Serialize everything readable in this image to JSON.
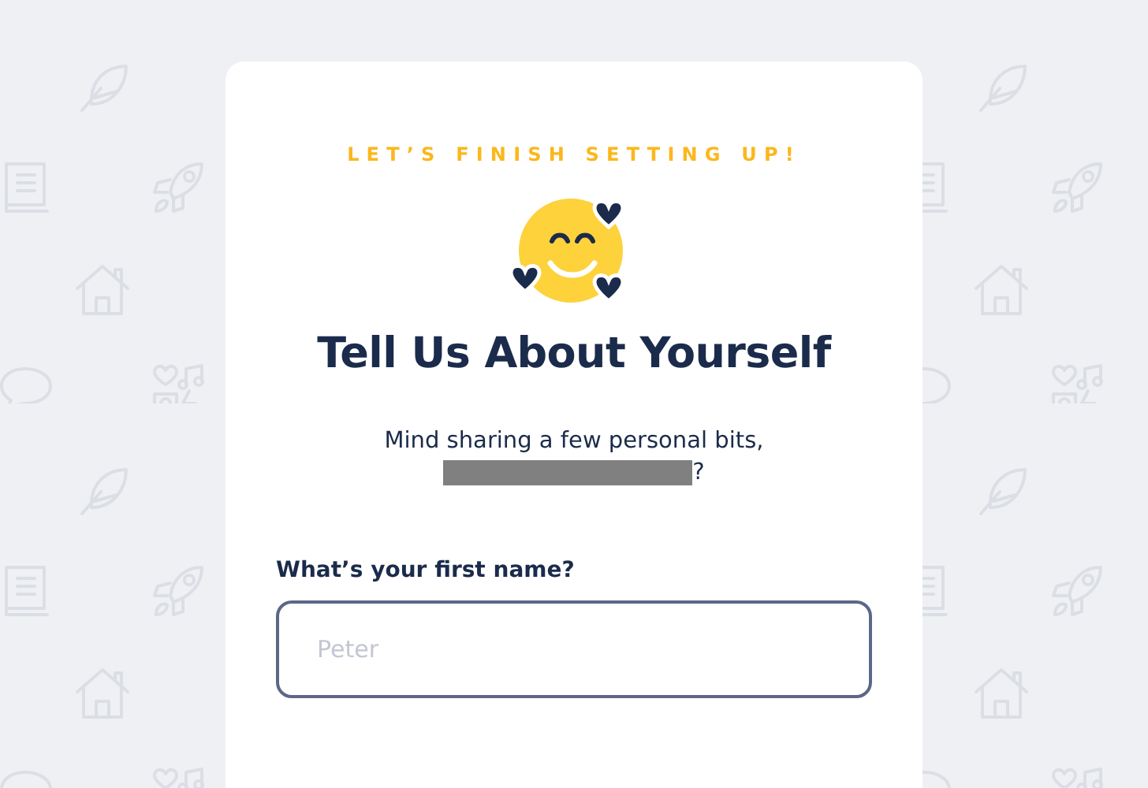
{
  "header": {
    "eyebrow": "LET’S FINISH SETTING UP!",
    "title": "Tell Us About Yourself",
    "subtitle": "Mind sharing a few personal bits,",
    "subtitle_end": "?"
  },
  "fields": [
    {
      "label": "What’s your first name?",
      "placeholder": "Peter"
    }
  ]
}
